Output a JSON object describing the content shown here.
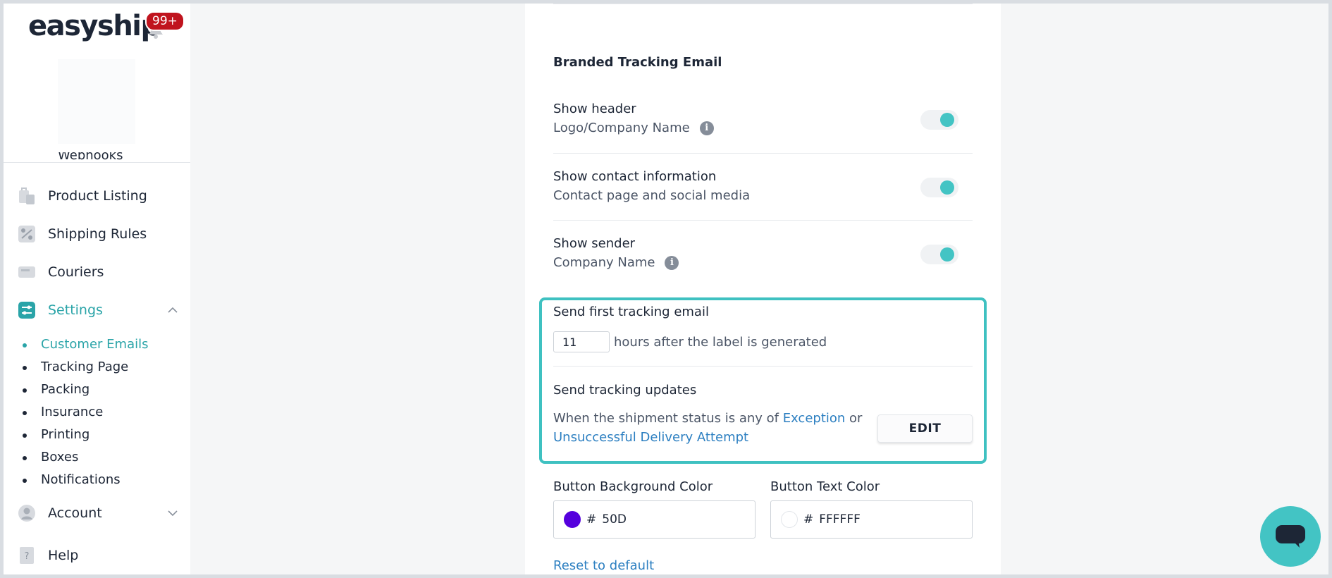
{
  "brand": {
    "name": "easyship",
    "notification_count": "99+"
  },
  "sidebar": {
    "partial_item": "Webhooks",
    "items": [
      {
        "label": "Product Listing",
        "icon": "product-listing-icon"
      },
      {
        "label": "Shipping Rules",
        "icon": "shipping-rules-icon"
      },
      {
        "label": "Couriers",
        "icon": "couriers-icon"
      },
      {
        "label": "Settings",
        "icon": "settings-icon"
      },
      {
        "label": "Account",
        "icon": "account-icon"
      },
      {
        "label": "Help",
        "icon": "help-icon"
      }
    ],
    "settings_sub": [
      "Customer Emails",
      "Tracking Page",
      "Packing",
      "Insurance",
      "Printing",
      "Boxes",
      "Notifications"
    ]
  },
  "main": {
    "section_title": "Branded Tracking Email",
    "options": [
      {
        "label": "Show header",
        "sub": "Logo/Company Name",
        "enabled": true
      },
      {
        "label": "Show contact information",
        "sub": "Contact page and social media",
        "enabled": true
      },
      {
        "label": "Show sender",
        "sub": "Company Name",
        "enabled": true
      }
    ],
    "first_email": {
      "label": "Send first tracking email",
      "hours": "11",
      "suffix": "hours after the label is generated"
    },
    "updates": {
      "label": "Send tracking updates",
      "prefix": "When the shipment status is any of",
      "status_1": "Exception",
      "connector": "or",
      "status_2": "Unsuccessful Delivery Attempt",
      "edit_label": "EDIT"
    },
    "button_bg": {
      "label": "Button Background Color",
      "hash": "#",
      "value": "50D",
      "swatch": "#5500dd"
    },
    "button_text": {
      "label": "Button Text Color",
      "hash": "#",
      "value": "FFFFFF",
      "swatch": "#ffffff"
    },
    "reset_label": "Reset to default"
  },
  "colors": {
    "accent": "#43c4c4",
    "link": "#2c7fc1",
    "badge": "#c0141e"
  }
}
